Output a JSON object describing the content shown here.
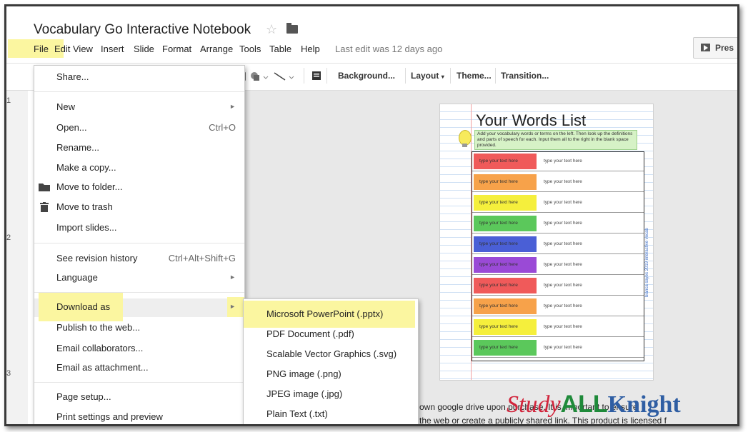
{
  "document": {
    "title": "Vocabulary Go Interactive Notebook",
    "last_edit": "Last edit was 12 days ago"
  },
  "icons": {
    "star": "star-icon",
    "folder": "folder-icon",
    "present": "play-icon"
  },
  "menubar": [
    "File",
    "Edit",
    "View",
    "Insert",
    "Slide",
    "Format",
    "Arrange",
    "Tools",
    "Table",
    "Help"
  ],
  "present_label": "Pres",
  "toolbar": {
    "background": "Background...",
    "layout": "Layout",
    "theme": "Theme...",
    "transition": "Transition..."
  },
  "row_numbers": [
    "1",
    "2",
    "3"
  ],
  "file_menu": {
    "share": "Share...",
    "new": "New",
    "open": "Open...",
    "open_shortcut": "Ctrl+O",
    "rename": "Rename...",
    "copy": "Make a copy...",
    "move_folder": "Move to folder...",
    "move_trash": "Move to trash",
    "import_slides": "Import slides...",
    "revision": "See revision history",
    "revision_shortcut": "Ctrl+Alt+Shift+G",
    "language": "Language",
    "download": "Download as",
    "publish": "Publish to the web...",
    "email_collab": "Email collaborators...",
    "email_attach": "Email as attachment...",
    "page_setup": "Page setup...",
    "print": "Print settings and preview"
  },
  "download_submenu": [
    "Microsoft PowerPoint (.pptx)",
    "PDF Document (.pdf)",
    "Scalable Vector Graphics (.svg)",
    "PNG image (.png)",
    "JPEG image (.jpg)",
    "Plain Text (.txt)"
  ],
  "slide": {
    "heading": "Your Words List",
    "instructions": "Add your vocabulary words or terms on the left. Then look up the definitions and parts of speech for each. Input them all to the right in the blank space provided.",
    "tab_text": "type your text here",
    "def_text": "type your text here",
    "tab_colors": [
      "#f05a5a",
      "#f7a24a",
      "#f5ef3c",
      "#5bc85b",
      "#4a5fd6",
      "#9a4ad6",
      "#f05a5a",
      "#f7a24a",
      "#f5ef3c",
      "#5bc85b"
    ],
    "side_note": "bianca sayes 2019 interactive vocab"
  },
  "caption_line1": "own google drive upon purchase. It is important to ensure",
  "caption_line2": "the web or create a publicly shared link. This product is licensed f",
  "brand": {
    "part1": "Study",
    "part2": "ALL",
    "part3": "Knight"
  }
}
